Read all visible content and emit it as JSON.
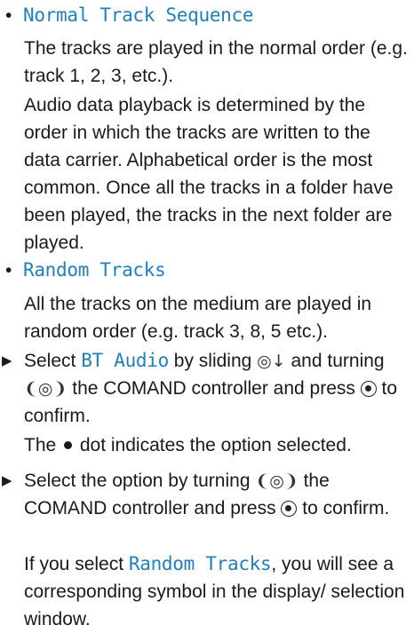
{
  "sections": [
    {
      "heading": "Normal Track Sequence",
      "paragraphs": [
        "The tracks are played in the normal order (e.g. track 1, 2, 3, etc.).",
        "Audio data playback is determined by the order in which the tracks are written to the data carrier. Alphabetical order is the most common. Once all the tracks in a folder have been played, the tracks in the next folder are played."
      ]
    },
    {
      "heading": "Random Tracks",
      "paragraphs": [
        "All the tracks on the medium are played in random order (e.g. track 3, 8, 5 etc.)."
      ]
    }
  ],
  "steps": {
    "step1": {
      "pre": "Select ",
      "highlight": "BT Audio",
      "mid1": " by sliding ",
      "mid2": " and turning ",
      "mid3": " the COMAND controller and press ",
      "end": " to confirm.",
      "note_pre": "The ",
      "note_post": " dot indicates the option selected."
    },
    "step2": {
      "pre": "Select the option by turning ",
      "mid": " the COMAND controller and press ",
      "end": " to confirm.",
      "note_pre": "If you select ",
      "note_highlight": "Random Tracks",
      "note_post": ", you will see a corresponding symbol in the display/ selection window."
    }
  },
  "icons": {
    "bullet": "bullet-dot",
    "step_arrow": "triangle-right-icon",
    "slide_down": "slide-down-controller-icon",
    "turn": "turn-controller-icon",
    "press": "press-controller-icon",
    "selected_dot": "selected-dot-icon"
  },
  "colors": {
    "text": "#1a1a1a",
    "highlight": "#1f7fbf"
  }
}
